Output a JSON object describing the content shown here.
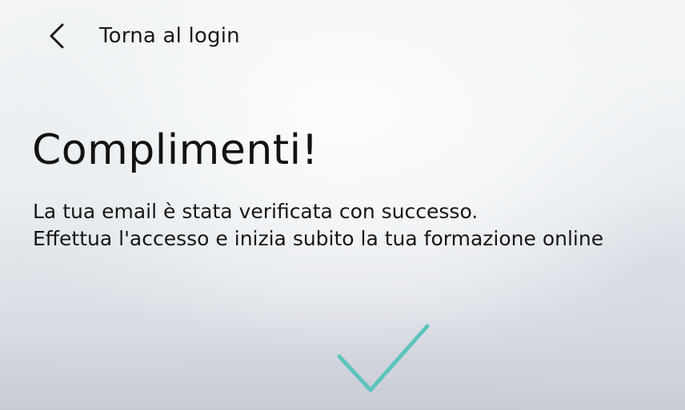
{
  "header": {
    "back_icon": "chevron-left-icon",
    "back_label": "Torna al login"
  },
  "main": {
    "title": "Complimenti!",
    "message_line1": "La tua email è stata verificata con successo.",
    "message_line2": "Effettua l'accesso e inizia subito la tua formazione online",
    "status_icon": "checkmark-icon"
  },
  "colors": {
    "accent": "#5dc4bd",
    "text": "#141414"
  }
}
